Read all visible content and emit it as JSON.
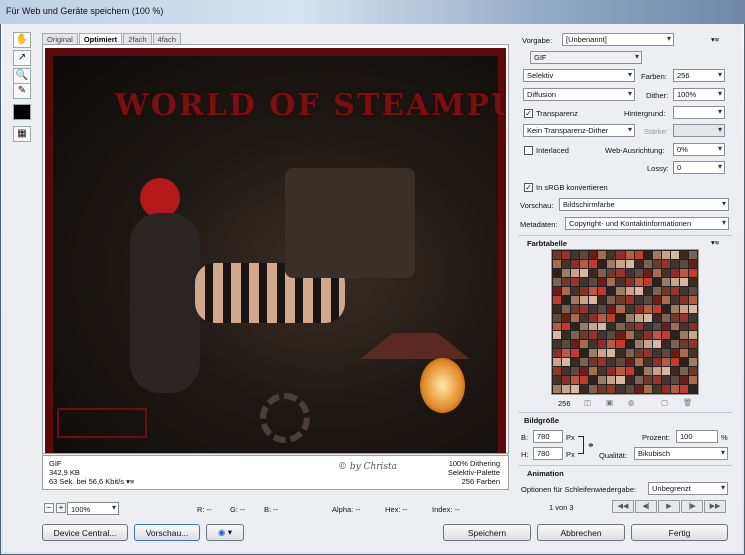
{
  "window": {
    "title": "Für Web und Geräte speichern (100 %)"
  },
  "tabs": [
    "Original",
    "Optimiert",
    "2fach",
    "4fach"
  ],
  "image_overlay_text": "WORLD OF STEAMPUNK",
  "info_left": [
    "GIF",
    "342,9 KB",
    "63 Sek. bei 56,6 Kbit/s"
  ],
  "info_right": [
    "100% Dithering",
    "Selektiv-Palette",
    "256 Farben"
  ],
  "status": {
    "zoom": "100%",
    "r": "R: --",
    "g": "G: --",
    "b": "B: --",
    "alpha": "Alpha: --",
    "hex": "Hex: --",
    "index": "Index: --"
  },
  "buttons": {
    "device_central": "Device Central...",
    "preview": "Vorschau...",
    "save": "Speichern",
    "cancel": "Abbrechen",
    "done": "Fertig"
  },
  "settings": {
    "preset_label": "Vorgabe:",
    "preset_value": "[Unbenannt]",
    "format": "GIF",
    "palette": "Selektiv",
    "colors_label": "Farben:",
    "colors_value": "256",
    "dither_algo": "Diffusion",
    "dither_label": "Dither:",
    "dither_value": "100%",
    "transparency_label": "Transparenz",
    "transparency_checked": true,
    "matte_label": "Hintergrund:",
    "trans_dither": "Kein Transparenz-Dither",
    "amount_label": "Stärke:",
    "interlaced_label": "Interlaced",
    "interlaced_checked": false,
    "web_snap_label": "Web-Ausrichtung:",
    "web_snap_value": "0%",
    "lossy_label": "Lossy:",
    "lossy_value": "0",
    "srgb_label": "In sRGB konvertieren",
    "srgb_checked": true,
    "preview_label": "Vorschau:",
    "preview_value": "Bildschirmfarbe",
    "metadata_label": "Metadaten:",
    "metadata_value": "Copyright- und Kontaktinformationen"
  },
  "color_table": {
    "title": "Farbtabelle",
    "count": "256",
    "colors": [
      "#6e3a2c",
      "#8b2f28",
      "#3a2a22",
      "#a86b4e",
      "#c9a48a",
      "#5b4a3e",
      "#2d211c",
      "#94342c",
      "#b85a45",
      "#7c6350",
      "#463428",
      "#d8b8a0",
      "#6a1e1a",
      "#9c7c64",
      "#3f3630",
      "#c23b2e"
    ]
  },
  "image_size": {
    "title": "Bildgröße",
    "w_label": "B:",
    "w_value": "780",
    "h_label": "H:",
    "h_value": "780",
    "unit": "Px",
    "percent_label": "Prozent:",
    "percent_value": "100",
    "percent_unit": "%",
    "quality_label": "Qualität:",
    "quality_value": "Bikubisch"
  },
  "animation": {
    "title": "Animation",
    "loop_label": "Optionen für Schleifenwiedergabe:",
    "loop_value": "Unbegrenzt",
    "frame": "1 von 3"
  }
}
